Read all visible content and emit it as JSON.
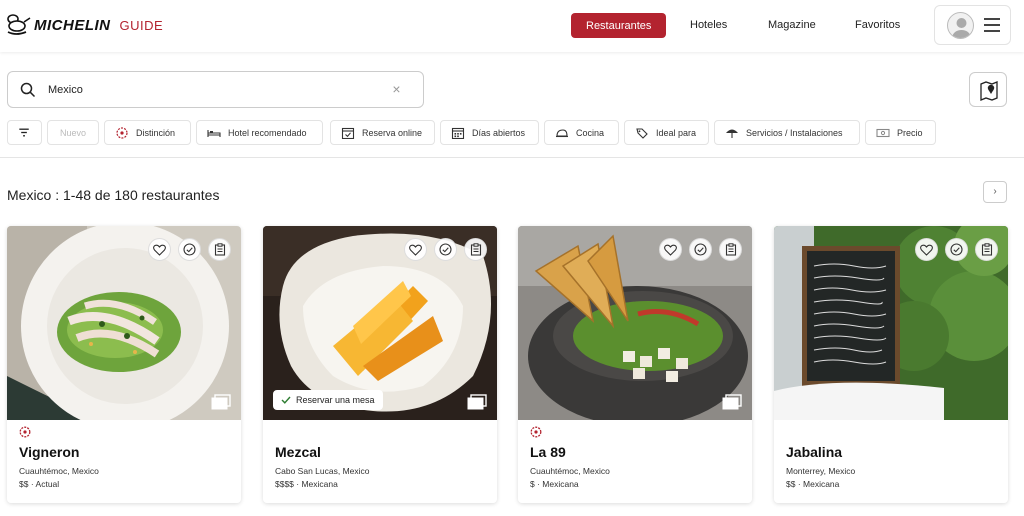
{
  "brand": {
    "name": "MICHELIN",
    "suffix": "GUIDE"
  },
  "nav": {
    "restaurants": "Restaurantes",
    "hotels": "Hoteles",
    "magazine": "Magazine",
    "favorites": "Favoritos"
  },
  "search": {
    "value": "Mexico",
    "clear": "×"
  },
  "filters": {
    "sort": "",
    "nuevo": "Nuevo",
    "distincion": "Distinción",
    "hotel": "Hotel recomendado",
    "reserva": "Reserva online",
    "dias": "Días abiertos",
    "cocina": "Cocina",
    "ideal": "Ideal para",
    "servicios": "Servicios / Instalaciones",
    "precio": "Precio"
  },
  "results": {
    "title": "Mexico : 1-48 de 180 restaurantes",
    "next": "›"
  },
  "accent_color": "#b3232f",
  "cards": [
    {
      "name": "Vigneron",
      "location": "Cuauhtémoc, Mexico",
      "price_cuisine": "$$ · Actual",
      "distinction": true,
      "reserve": ""
    },
    {
      "name": "Mezcal",
      "location": "Cabo San Lucas, Mexico",
      "price_cuisine": "$$$$ · Mexicana",
      "distinction": false,
      "reserve": "Reservar una mesa"
    },
    {
      "name": "La 89",
      "location": "Cuauhtémoc, Mexico",
      "price_cuisine": "$ · Mexicana",
      "distinction": true,
      "reserve": ""
    },
    {
      "name": "Jabalina",
      "location": "Monterrey, Mexico",
      "price_cuisine": "$$ · Mexicana",
      "distinction": false,
      "reserve": ""
    }
  ]
}
